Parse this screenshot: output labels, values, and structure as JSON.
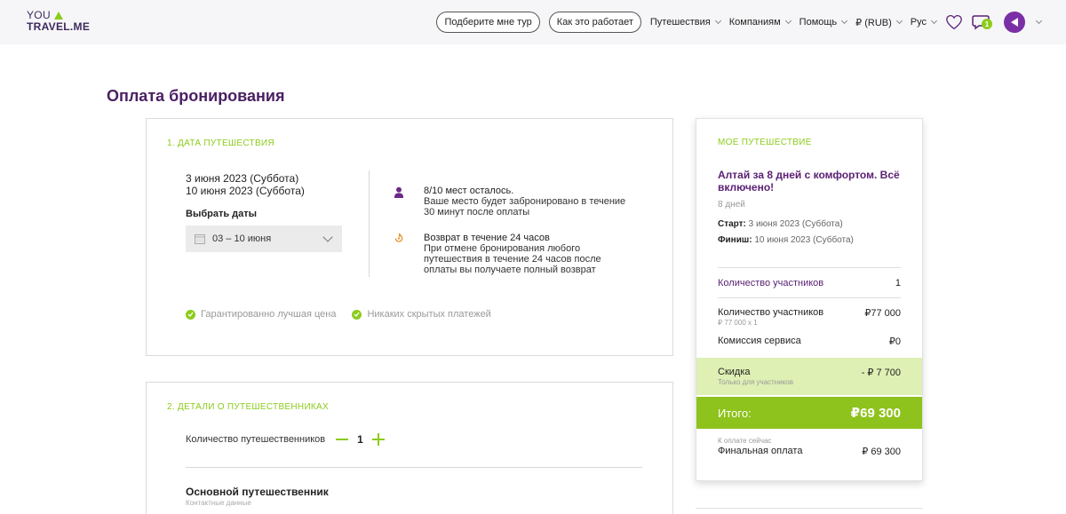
{
  "logo": {
    "line1": "YOU",
    "line2": "TRAVEL.ME"
  },
  "nav": {
    "pick_tour": "Подберите мне тур",
    "how_it_works": "Как это работает",
    "items": [
      "Путешествия",
      "Компаниям",
      "Помощь",
      "₽ (RUB)",
      "Рус"
    ],
    "chat_badge": "1"
  },
  "page_title": "Оплата бронирования",
  "trip_date": {
    "title": "1.  ДАТА ПУТЕШЕСТВИЯ",
    "start": "3 июня 2023 (Суббота)",
    "end": "10 июня 2023 (Суббота)",
    "choose_label": "Выбрать даты",
    "range_value": "03 – 10 июня",
    "seats_title": "8/10 мест осталось.",
    "seats_text": "Ваше место будет забронировано в течение 30 минут после оплаты",
    "refund_title": "Возврат в течение 24 часов",
    "refund_text": "При отмене бронирования любого путешествия в течение 24 часов после оплаты вы получаете полный возврат",
    "perk1": "Гарантированно лучшая цена",
    "perk2": "Никаких скрытых платежей"
  },
  "travelers": {
    "title": "2.  ДЕТАЛИ О ПУТЕШЕСТВЕННИКАХ",
    "count_label": "Количество путешественников",
    "count": "1",
    "main_title": "Основной путешественник",
    "main_sub": "Контактные данные"
  },
  "summary": {
    "label": "МОЕ ПУТЕШЕСТВИЕ",
    "trip_name": "Алтай за 8 дней с комфортом. Всё включено!",
    "days": "8 дней",
    "start_label": "Старт:",
    "start_value": " 3 июня 2023 (Суббота)",
    "finish_label": "Финиш:",
    "finish_value": " 10 июня 2023 (Суббота)",
    "participants_label": "Количество участников",
    "participants_value": "1",
    "price_label": "Количество участников",
    "price_sub": "₽ 77 000 x 1",
    "price_value": "₽77 000",
    "fee_label": "Комиссия сервиса",
    "fee_value": "₽0",
    "discount_label": "Скидка",
    "discount_sub": "Только для участников",
    "discount_value": "- ₽ 7 700",
    "total_label": "Итого:",
    "total_value": "₽69 300",
    "pay_now_sub": "К оплате сейчас",
    "final_label": "Финальная оплата",
    "final_value": "₽ 69 300"
  },
  "colors": {
    "accent": "#8ccc1c",
    "brand": "#5b2174"
  }
}
